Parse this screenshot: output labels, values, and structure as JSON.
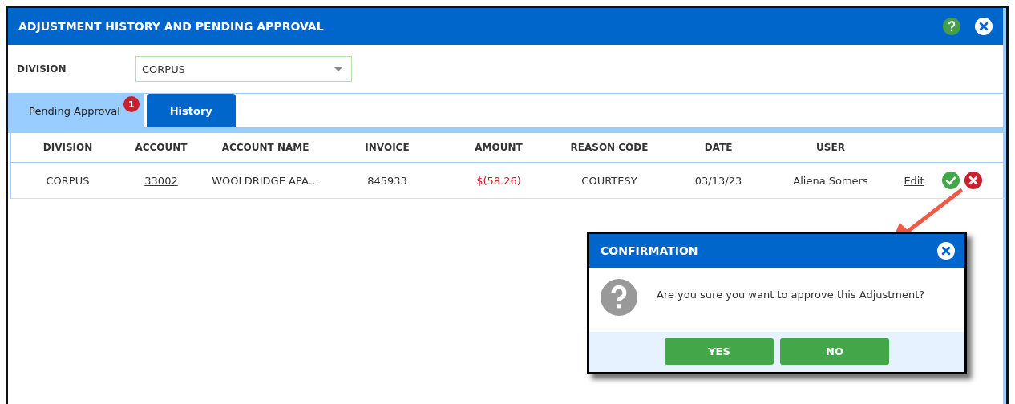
{
  "window": {
    "title": "ADJUSTMENT HISTORY AND PENDING APPROVAL"
  },
  "filter": {
    "label": "DIVISION",
    "value": "CORPUS"
  },
  "tabs": [
    {
      "label": "Pending Approval",
      "selected": true,
      "badge": "1"
    },
    {
      "label": "History",
      "selected": false
    }
  ],
  "table": {
    "columns": [
      "DIVISION",
      "ACCOUNT",
      "ACCOUNT NAME",
      "INVOICE",
      "AMOUNT",
      "REASON CODE",
      "DATE",
      "USER"
    ],
    "rows": [
      {
        "cells": [
          "CORPUS",
          "33002",
          "WOOLDRIDGE APA…",
          "845933",
          "$(58.26)",
          "COURTESY",
          "03/13/23",
          "Aliena Somers"
        ],
        "action": "Edit"
      }
    ]
  },
  "dialog": {
    "title": "CONFIRMATION",
    "message": "Are you sure you want to approve this Adjustment?",
    "buttons": [
      "YES",
      "NO"
    ]
  }
}
